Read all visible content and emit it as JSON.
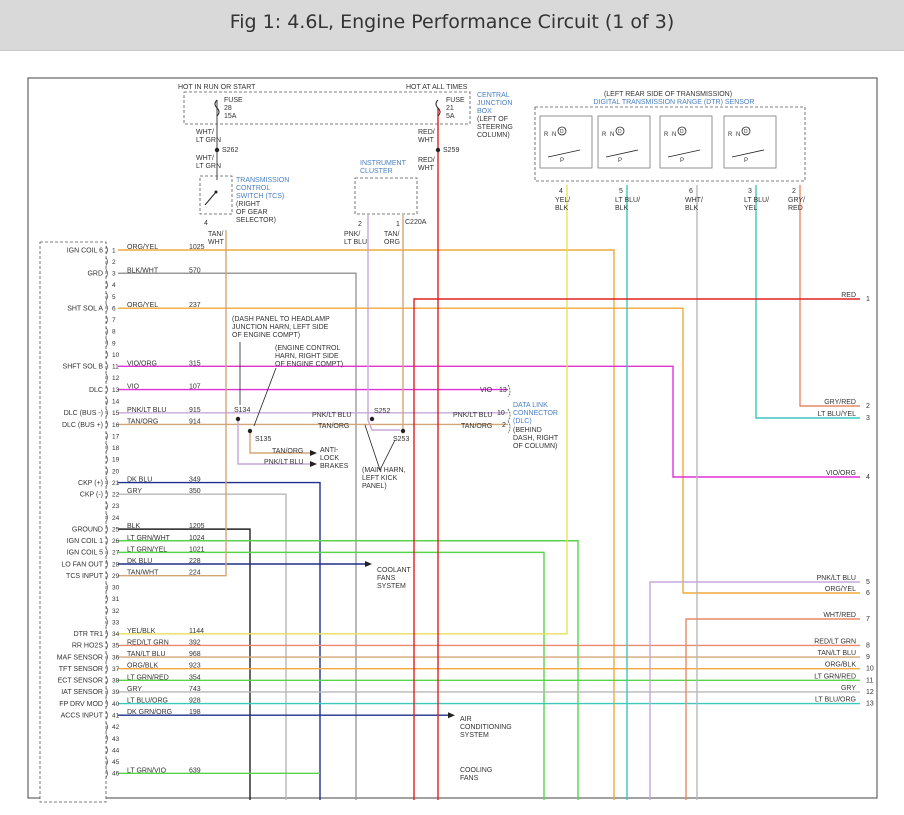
{
  "header": {
    "title": "Fig 1: 4.6L, Engine Performance Circuit (1 of 3)"
  },
  "colors": {
    "orange": "#f2a83a",
    "gray": "#9a9a9a",
    "red": "#e02020",
    "magenta": "#e030d8",
    "lavender": "#c6a8d8",
    "tan": "#d2a679",
    "navy": "#1f2f8c",
    "ltgray": "#b8b8b8",
    "black": "#222222",
    "green": "#57d44a",
    "teal": "#3cc8bd",
    "yellow": "#e8e05a",
    "salmon": "#e88a6a",
    "wire_text": "#333333",
    "blue_text": "#4a7fc1"
  },
  "top": {
    "hot_run": "HOT IN RUN OR START",
    "hot_all": "HOT AT ALL TIMES",
    "fuse_a": [
      "FUSE",
      "28",
      "15A"
    ],
    "fuse_b": [
      "FUSE",
      "21",
      "5A"
    ],
    "cjb": [
      "CENTRAL",
      "JUNCTION",
      "BOX"
    ],
    "cjb_loc": [
      "(LEFT OF",
      "STEERING",
      "COLUMN)"
    ],
    "wht_lt_grn": [
      "WHT/",
      "LT GRN"
    ],
    "red_wht": [
      "RED/",
      "WHT"
    ],
    "s262": "S262",
    "s259": "S259",
    "tcs": [
      "TRANSMISSION",
      "CONTROL",
      "SWITCH (TCS)"
    ],
    "tcs_loc": [
      "(RIGHT",
      "OF GEAR",
      "SELECTOR)"
    ],
    "tcs_pin": "4",
    "tan_wht": [
      "TAN/",
      "WHT"
    ],
    "instrument_cluster": [
      "INSTRUMENT",
      "CLUSTER"
    ],
    "ic_pins": [
      "2",
      "1"
    ],
    "c220a": "C220A",
    "pnk_lt_blu": [
      "PNK/",
      "LT BLU"
    ],
    "tan_org": [
      "TAN/",
      "ORG"
    ]
  },
  "dtr": {
    "title": "(LEFT REAR SIDE OF TRANSMISSION)",
    "name": "DIGITAL TRANSMISSION RANGE (DTR) SENSOR",
    "pins": [
      "4",
      "5",
      "6",
      "3",
      "2"
    ],
    "wire_labels": [
      [
        "YEL/",
        "BLK"
      ],
      [
        "LT BLU/",
        "BLK"
      ],
      [
        "WHT/",
        "BLK"
      ],
      [
        "LT BLU/",
        "YEL"
      ],
      [
        "GRY/",
        "RED"
      ]
    ]
  },
  "pcm_labels": [
    {
      "pin": "1",
      "label": "IGN COIL 6"
    },
    {
      "pin": "3",
      "label": "GRD"
    },
    {
      "pin": "6",
      "label": "SHT SOL A"
    },
    {
      "pin": "11",
      "label": "SHFT SOL B"
    },
    {
      "pin": "13",
      "label": "DLC"
    },
    {
      "pin": "15",
      "label": "DLC (BUS -)"
    },
    {
      "pin": "16",
      "label": "DLC (BUS +)"
    },
    {
      "pin": "21",
      "label": "CKP (+)"
    },
    {
      "pin": "22",
      "label": "CKP (-)"
    },
    {
      "pin": "25",
      "label": "GROUND"
    },
    {
      "pin": "26",
      "label": "IGN COIL 1"
    },
    {
      "pin": "27",
      "label": "IGN COIL 5"
    },
    {
      "pin": "28",
      "label": "LO FAN OUT"
    },
    {
      "pin": "29",
      "label": "TCS INPUT"
    },
    {
      "pin": "34",
      "label": "DTR TR1"
    },
    {
      "pin": "35",
      "label": "RR HO2S"
    },
    {
      "pin": "36",
      "label": "MAF SENSOR"
    },
    {
      "pin": "37",
      "label": "TFT SENSOR"
    },
    {
      "pin": "38",
      "label": "ECT SENSOR"
    },
    {
      "pin": "39",
      "label": "IAT SENSOR"
    },
    {
      "pin": "40",
      "label": "FP DRV MOD"
    },
    {
      "pin": "41",
      "label": "ACCS INPUT"
    }
  ],
  "pcm_wires": [
    {
      "pin": "1",
      "color": "ORG/YEL",
      "circuit": "1025"
    },
    {
      "pin": "3",
      "color": "BLK/WHT",
      "circuit": "570"
    },
    {
      "pin": "6",
      "color": "ORG/YEL",
      "circuit": "237"
    },
    {
      "pin": "11",
      "color": "VIO/ORG",
      "circuit": "315"
    },
    {
      "pin": "13",
      "color": "VIO",
      "circuit": "107"
    },
    {
      "pin": "15",
      "color": "PNK/LT BLU",
      "circuit": "915"
    },
    {
      "pin": "16",
      "color": "TAN/ORG",
      "circuit": "914"
    },
    {
      "pin": "21",
      "color": "DK BLU",
      "circuit": "349"
    },
    {
      "pin": "22",
      "color": "GRY",
      "circuit": "350"
    },
    {
      "pin": "25",
      "color": "BLK",
      "circuit": "1205"
    },
    {
      "pin": "26",
      "color": "LT GRN/WHT",
      "circuit": "1024"
    },
    {
      "pin": "27",
      "color": "LT GRN/YEL",
      "circuit": "1021"
    },
    {
      "pin": "28",
      "color": "DK BLU",
      "circuit": "228"
    },
    {
      "pin": "29",
      "color": "TAN/WHT",
      "circuit": "224"
    },
    {
      "pin": "34",
      "color": "YEL/BLK",
      "circuit": "1144"
    },
    {
      "pin": "35",
      "color": "RED/LT GRN",
      "circuit": "392"
    },
    {
      "pin": "36",
      "color": "TAN/LT BLU",
      "circuit": "968"
    },
    {
      "pin": "37",
      "color": "ORG/BLK",
      "circuit": "923"
    },
    {
      "pin": "38",
      "color": "LT GRN/RED",
      "circuit": "354"
    },
    {
      "pin": "39",
      "color": "GRY",
      "circuit": "743"
    },
    {
      "pin": "40",
      "color": "LT BLU/ORG",
      "circuit": "928"
    },
    {
      "pin": "41",
      "color": "DK GRN/ORG",
      "circuit": "198"
    },
    {
      "pin": "46",
      "color": "LT GRN/VIO",
      "circuit": "639"
    }
  ],
  "pcm_pins": [
    "1",
    "2",
    "3",
    "4",
    "5",
    "6",
    "7",
    "8",
    "9",
    "10",
    "11",
    "12",
    "13",
    "14",
    "15",
    "16",
    "17",
    "18",
    "19",
    "20",
    "21",
    "22",
    "23",
    "24",
    "25",
    "26",
    "27",
    "28",
    "29",
    "30",
    "31",
    "32",
    "33",
    "34",
    "35",
    "36",
    "37",
    "38",
    "39",
    "40",
    "41",
    "42",
    "43",
    "44",
    "45",
    "46"
  ],
  "mid": {
    "dash_panel": [
      "(DASH PANEL TO HEADLAMP",
      "JUNCTION HARN, LEFT SIDE",
      "OF ENGINE COMPT)"
    ],
    "engine_control": [
      "(ENGINE CONTROL",
      "HARN, RIGHT SIDE",
      "OF ENGINE COMPT)"
    ],
    "s134": "S134",
    "s135": "S135",
    "s252": "S252",
    "s253": "S253",
    "pnk_lt_blu": "PNK/LT BLU",
    "tan_org": "TAN/ORG",
    "abs": [
      "ANTI-",
      "LOCK",
      "BRAKES"
    ],
    "main_harn": [
      "(MAIN HARN,",
      "LEFT KICK",
      "PANEL)"
    ],
    "dlc_vio": "VIO",
    "dlc_pins": [
      "13",
      "10",
      "2"
    ],
    "dlc_name": [
      "DATA LINK",
      "CONNECTOR",
      "(DLC)"
    ],
    "dlc_loc": [
      "(BEHIND",
      "DASH, RIGHT",
      "OF COLUMN)"
    ],
    "coolant": [
      "COOLANT",
      "FANS",
      "SYSTEM"
    ],
    "air": [
      "AIR",
      "CONDITIONING",
      "SYSTEM"
    ],
    "cooling": [
      "COOLING",
      "FANS"
    ]
  },
  "right_edge": [
    {
      "label": "RED",
      "num": "1"
    },
    {
      "label": "GRY/RED",
      "num": "2"
    },
    {
      "label": "LT BLU/YEL",
      "num": "3"
    },
    {
      "label": "VIO/ORG",
      "num": "4"
    },
    {
      "label": "PNK/LT BLU",
      "num": "5"
    },
    {
      "label": "ORG/YEL",
      "num": "6"
    },
    {
      "label": "WHT/RED",
      "num": "7"
    },
    {
      "label": "RED/LT GRN",
      "num": "8"
    },
    {
      "label": "TAN/LT BLU",
      "num": "9"
    },
    {
      "label": "ORG/BLK",
      "num": "10"
    },
    {
      "label": "LT GRN/RED",
      "num": "11"
    },
    {
      "label": "GRY",
      "num": "12"
    },
    {
      "label": "LT BLU/ORG",
      "num": "13"
    }
  ]
}
